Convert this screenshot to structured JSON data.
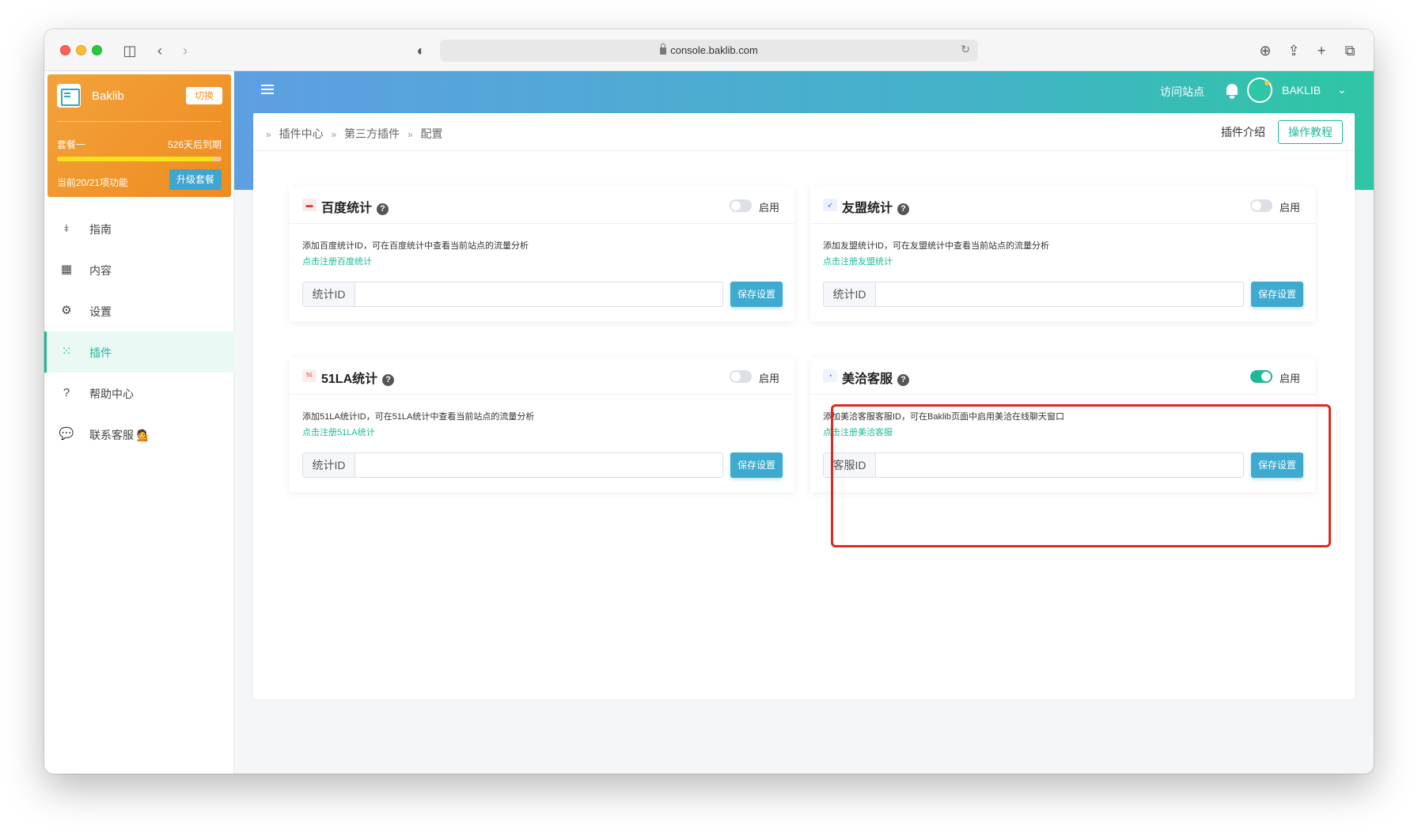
{
  "browser": {
    "url": "console.baklib.com"
  },
  "sidebar": {
    "brand": "Baklib",
    "switch_label": "切换",
    "plan_name": "套餐一",
    "plan_expire": "526天后到期",
    "plan_usage_fraction": 0.95,
    "plan_features": "当前20/21项功能",
    "upgrade_label": "升级套餐",
    "items": [
      {
        "label": "指南",
        "icon": "sliders-icon"
      },
      {
        "label": "内容",
        "icon": "grid-icon"
      },
      {
        "label": "设置",
        "icon": "gear-icon"
      },
      {
        "label": "插件",
        "icon": "apps-icon",
        "active": true
      },
      {
        "label": "帮助中心",
        "icon": "question-circle-icon"
      },
      {
        "label": "联系客服 💁",
        "icon": "chat-icon"
      }
    ]
  },
  "topbar": {
    "visit_site": "访问站点",
    "username": "BAKLIB"
  },
  "breadcrumb": [
    "插件中心",
    "第三方插件",
    "配置"
  ],
  "header_actions": {
    "plugin_intro": "插件介绍",
    "tutorial": "操作教程"
  },
  "colors": {
    "accent": "#1fb899",
    "save_button": "#3eaad0",
    "highlight": "#dc2b20"
  },
  "plugins": [
    {
      "title": "百度统计",
      "enabled": false,
      "toggle_label": "启用",
      "description": "添加百度统计ID，可在百度统计中查看当前站点的流量分析",
      "link": "点击注册百度统计",
      "input_prefix": "统计ID",
      "input_value": "",
      "save_label": "保存设置"
    },
    {
      "title": "友盟统计",
      "enabled": false,
      "toggle_label": "启用",
      "description": "添加友盟统计ID，可在友盟统计中查看当前站点的流量分析",
      "link": "点击注册友盟统计",
      "input_prefix": "统计ID",
      "input_value": "",
      "save_label": "保存设置"
    },
    {
      "title": "51LA统计",
      "enabled": false,
      "toggle_label": "启用",
      "description": "添加51LA统计ID，可在51LA统计中查看当前站点的流量分析",
      "link": "点击注册51LA统计",
      "input_prefix": "统计ID",
      "input_value": "",
      "save_label": "保存设置"
    },
    {
      "title": "美洽客服",
      "enabled": true,
      "toggle_label": "启用",
      "description": "添加美洽客服客服ID，可在Baklib页面中启用美洽在线聊天窗口",
      "link": "点击注册美洽客服",
      "input_prefix": "客服ID",
      "input_value": "",
      "save_label": "保存设置"
    }
  ]
}
